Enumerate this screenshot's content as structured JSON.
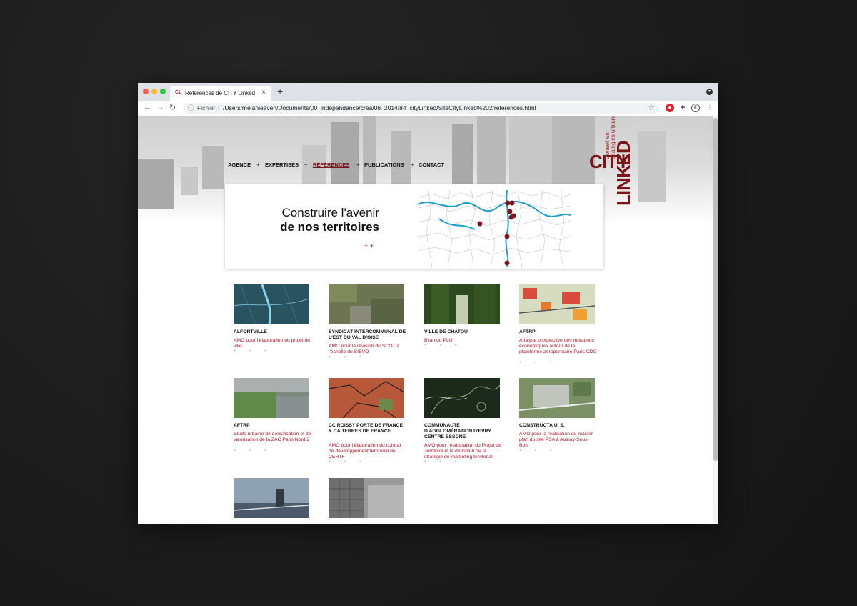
{
  "browser": {
    "tab_title": "Références de CITY Linked",
    "tab_favicon": "CL",
    "tab_close": "×",
    "new_tab": "+",
    "address_scheme": "Fichier",
    "address_url": "/Users/melanieeven/Documents/00_indépendance/créa/06_2014/84_cityLinked/SiteCityLinked%202/references.html",
    "icons": [
      "back-icon",
      "forward-icon",
      "reload-icon",
      "info-icon",
      "bookmark-star-icon",
      "extension-icon",
      "puzzle-icon",
      "profile-icon",
      "menu-icon"
    ]
  },
  "site": {
    "nav": [
      {
        "label": "AGENCE"
      },
      {
        "label": "EXPERTISES"
      },
      {
        "label": "RÉFÉRENCES",
        "active": true
      },
      {
        "label": "PUBLICATIONS"
      },
      {
        "label": "CONTACT"
      }
    ],
    "nav_separator": "+",
    "logo": {
      "city": "CITY",
      "linked": "LINKED",
      "tagline": "Conseil en stratégies urbaines"
    },
    "banner": {
      "line1": "Construire l'avenir",
      "line2": "de nos territoires",
      "plus": "+ +"
    },
    "accent_color": "#7a1418"
  },
  "references": [
    {
      "title": "ALFORTVILLE",
      "desc": "AMO pour l'élaboration du projet de ville"
    },
    {
      "title": "SYNDICAT INTERCOMMUNAL DE L'EST DU VAL D'OISE",
      "desc": "AMO pour la révision du SCOT à l'échelle du SIEVO"
    },
    {
      "title": "VILLE DE CHATOU",
      "desc": "Bilan du PLU"
    },
    {
      "title": "AFTRP",
      "desc": "Analyse prospective des mutations économiques autour de la plateforme aéroportuaire Paris CDG"
    },
    {
      "title": "AFTRP",
      "desc": "Etude urbaine de densification et de valorisation de la ZAC Paris Nord 2"
    },
    {
      "title": "CC ROISSY PORTE DE FRANCE & CA TERRES DE FRANCE",
      "desc": "AMO pour l'élaboration du contrat de développement territorial du CERTF"
    },
    {
      "title": "COMMUNAUTÉ D'AGGLOMÉRATION D'EVRY CENTRE ESSONE",
      "desc": "AMO pour l'élaboration du Projet de Territoire et la définition de la stratégie de marketing territorial"
    },
    {
      "title": "CONSTRUCTA U. S.",
      "desc": "AMO pour la réalisation du master plan du site PSA à Aulnay-Sous-Bois"
    },
    {
      "title": "",
      "desc": ""
    },
    {
      "title": "",
      "desc": ""
    }
  ],
  "card_plus": "+ + +"
}
